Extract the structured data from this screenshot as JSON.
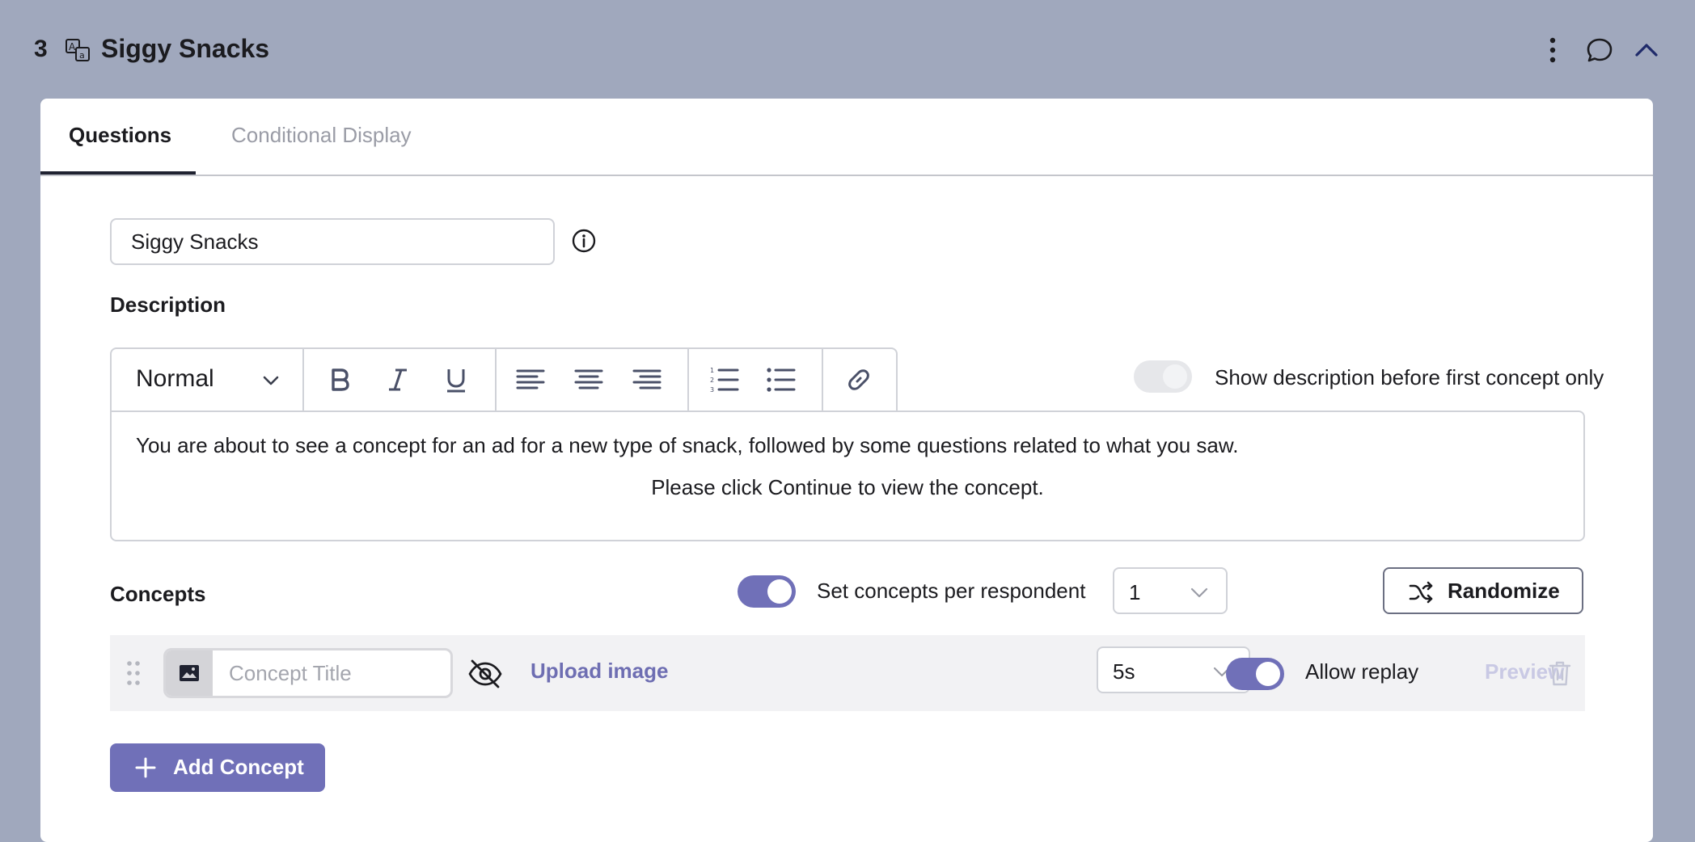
{
  "header": {
    "number": "3",
    "title": "Siggy Snacks",
    "type_icon": "translate-icon",
    "actions": [
      "kebab-menu-icon",
      "comment-icon",
      "chevron-up-icon"
    ]
  },
  "tabs": [
    {
      "label": "Questions",
      "active": true
    },
    {
      "label": "Conditional Display",
      "active": false
    }
  ],
  "title_field": {
    "value": "Siggy Snacks"
  },
  "description": {
    "label": "Description",
    "toolbar": {
      "text_style": "Normal",
      "buttons": [
        "bold-icon",
        "italic-icon",
        "underline-icon",
        "align-left-icon",
        "align-center-icon",
        "align-right-icon",
        "ordered-list-icon",
        "bullet-list-icon",
        "link-icon"
      ]
    },
    "toggle": {
      "label": "Show description before first concept only",
      "on": false
    },
    "line1": "You are about to see a concept for an ad for a new type of snack, followed by some questions related to what you saw.",
    "line2": "Please click Continue to view the concept."
  },
  "concepts": {
    "label": "Concepts",
    "per_respondent_toggle": {
      "label": "Set concepts per respondent",
      "on": true
    },
    "per_respondent_value": "1",
    "randomize_label": "Randomize",
    "items": [
      {
        "title_placeholder": "Concept Title",
        "upload_label": "Upload image",
        "duration": "5s",
        "allow_replay": {
          "label": "Allow replay",
          "on": true
        },
        "preview_label": "Preview"
      }
    ],
    "add_label": "Add Concept"
  },
  "colors": {
    "background": "#a0a8bd",
    "accent": "#7070b8",
    "link": "#6e6eb2",
    "disabled_link": "#c9c9e4"
  }
}
